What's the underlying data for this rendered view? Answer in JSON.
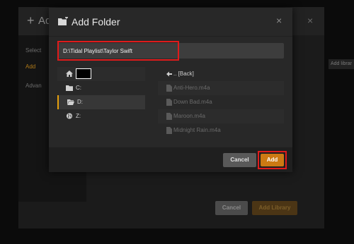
{
  "background_dialog": {
    "title": "Add",
    "sidebar_items": [
      "Select",
      "Add",
      "Advan"
    ],
    "cancel_label": "Cancel",
    "add_library_label": "Add Library",
    "tooltip": "Add librar"
  },
  "dialog": {
    "title": "Add Folder",
    "close_icon": "×",
    "path_value": "D:\\Tidal Playlist\\Taylor Swift",
    "drives": [
      {
        "label": "",
        "icon": "home-icon"
      },
      {
        "label": "C:",
        "icon": "folder-icon"
      },
      {
        "label": "D:",
        "icon": "folder-open-icon",
        "selected": true
      },
      {
        "label": "Z:",
        "icon": "network-icon"
      }
    ],
    "back_label": ".. [Back]",
    "files": [
      "Anti-Hero.m4a",
      "Down Bad.m4a",
      "Maroon.m4a",
      "Midnight Rain.m4a"
    ],
    "cancel_label": "Cancel",
    "add_label": "Add"
  },
  "colors": {
    "accent": "#e5a00d",
    "add_button": "#cc7a13",
    "highlight_box": "#e01b1b"
  }
}
